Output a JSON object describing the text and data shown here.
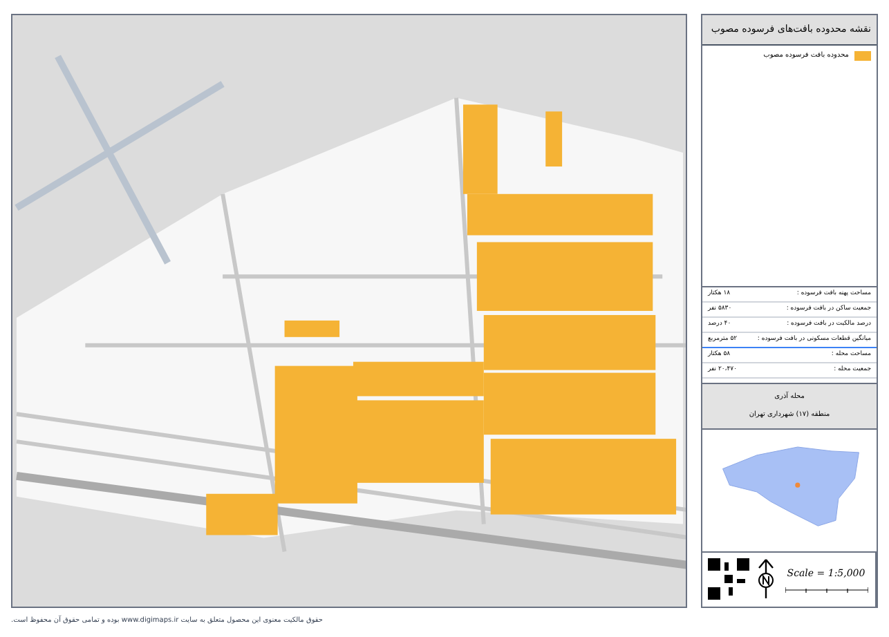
{
  "panel": {
    "title": "نقشه محدوده بافت‌های فرسوده مصوب",
    "legend": [
      {
        "label": "محدوده بافت فرسوده مصوب",
        "color": "#f5b335"
      }
    ],
    "stats": [
      {
        "label": "مساحت پهنه بافت فرسوده :",
        "value": "۱۸ هکتار"
      },
      {
        "label": "جمعیت ساکن در بافت فرسوده :",
        "value": "۵۸۳۰ نفر"
      },
      {
        "label": "درصد مالکیت در بافت فرسوده :",
        "value": "۴۰ درصد"
      },
      {
        "label": "میانگین قطعات مسکونی در بافت فرسوده :",
        "value": "۵۲ مترمربع"
      },
      {
        "label": "مساحت محله :",
        "value": "۵۸ هکتار"
      },
      {
        "label": "جمعیت محله :",
        "value": "۲۰،۴۷۰ نفر"
      }
    ],
    "neighborhood": "محله آذری",
    "district": "منطقه (۱۷) شهرداری تهران",
    "scale": "Scale = 1:5,000"
  },
  "footer": "حقوق مالکیت معنوی این محصول متعلق به سایت www.digimaps.ir بوده و تمامی حقوق آن محفوظ است."
}
